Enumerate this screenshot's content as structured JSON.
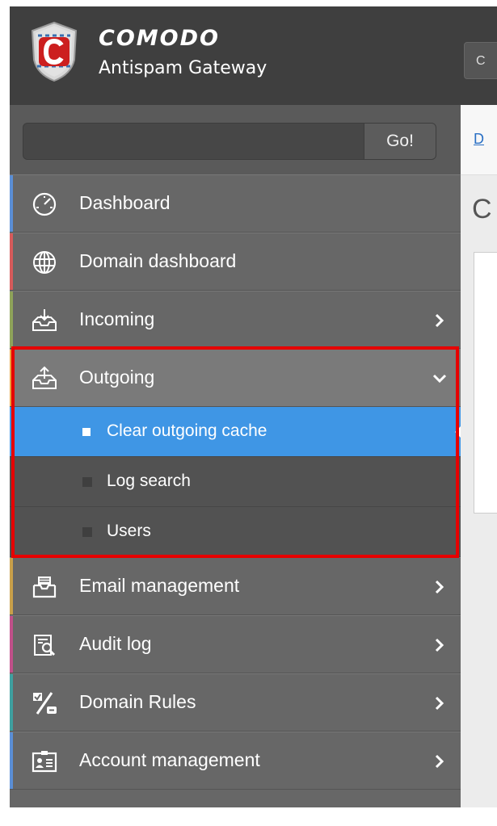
{
  "header": {
    "brand": "COMODO",
    "product": "Antispam Gateway",
    "button_label": "C"
  },
  "search": {
    "value": "",
    "go_label": "Go!"
  },
  "menu": [
    {
      "label": "Dashboard",
      "icon": "dashboard-gauge-icon",
      "stripe": "#5b8fd6",
      "has_arrow": false
    },
    {
      "label": "Domain dashboard",
      "icon": "globe-icon",
      "stripe": "#d65b5b",
      "has_arrow": false
    },
    {
      "label": "Incoming",
      "icon": "inbox-download-icon",
      "stripe": "#8fa35a",
      "has_arrow": true
    },
    {
      "label": "Outgoing",
      "icon": "outbox-upload-icon",
      "stripe": "#e8a33c",
      "expanded": true
    }
  ],
  "outgoing_submenu": [
    {
      "label": "Clear outgoing cache",
      "active": true
    },
    {
      "label": "Log search",
      "active": false
    },
    {
      "label": "Users",
      "active": false
    }
  ],
  "menu_after": [
    {
      "label": "Email management",
      "icon": "email-tray-icon",
      "stripe": "#c9a04a"
    },
    {
      "label": "Audit log",
      "icon": "audit-search-icon",
      "stripe": "#c0508a"
    },
    {
      "label": "Domain Rules",
      "icon": "percent-rules-icon",
      "stripe": "#3fa0a0"
    },
    {
      "label": "Account management",
      "icon": "account-card-icon",
      "stripe": "#5b8fd6"
    }
  ],
  "main": {
    "breadcrumb": "D",
    "page_title": "C"
  },
  "colors": {
    "active": "#3f96e5",
    "highlight": "#e60000"
  }
}
